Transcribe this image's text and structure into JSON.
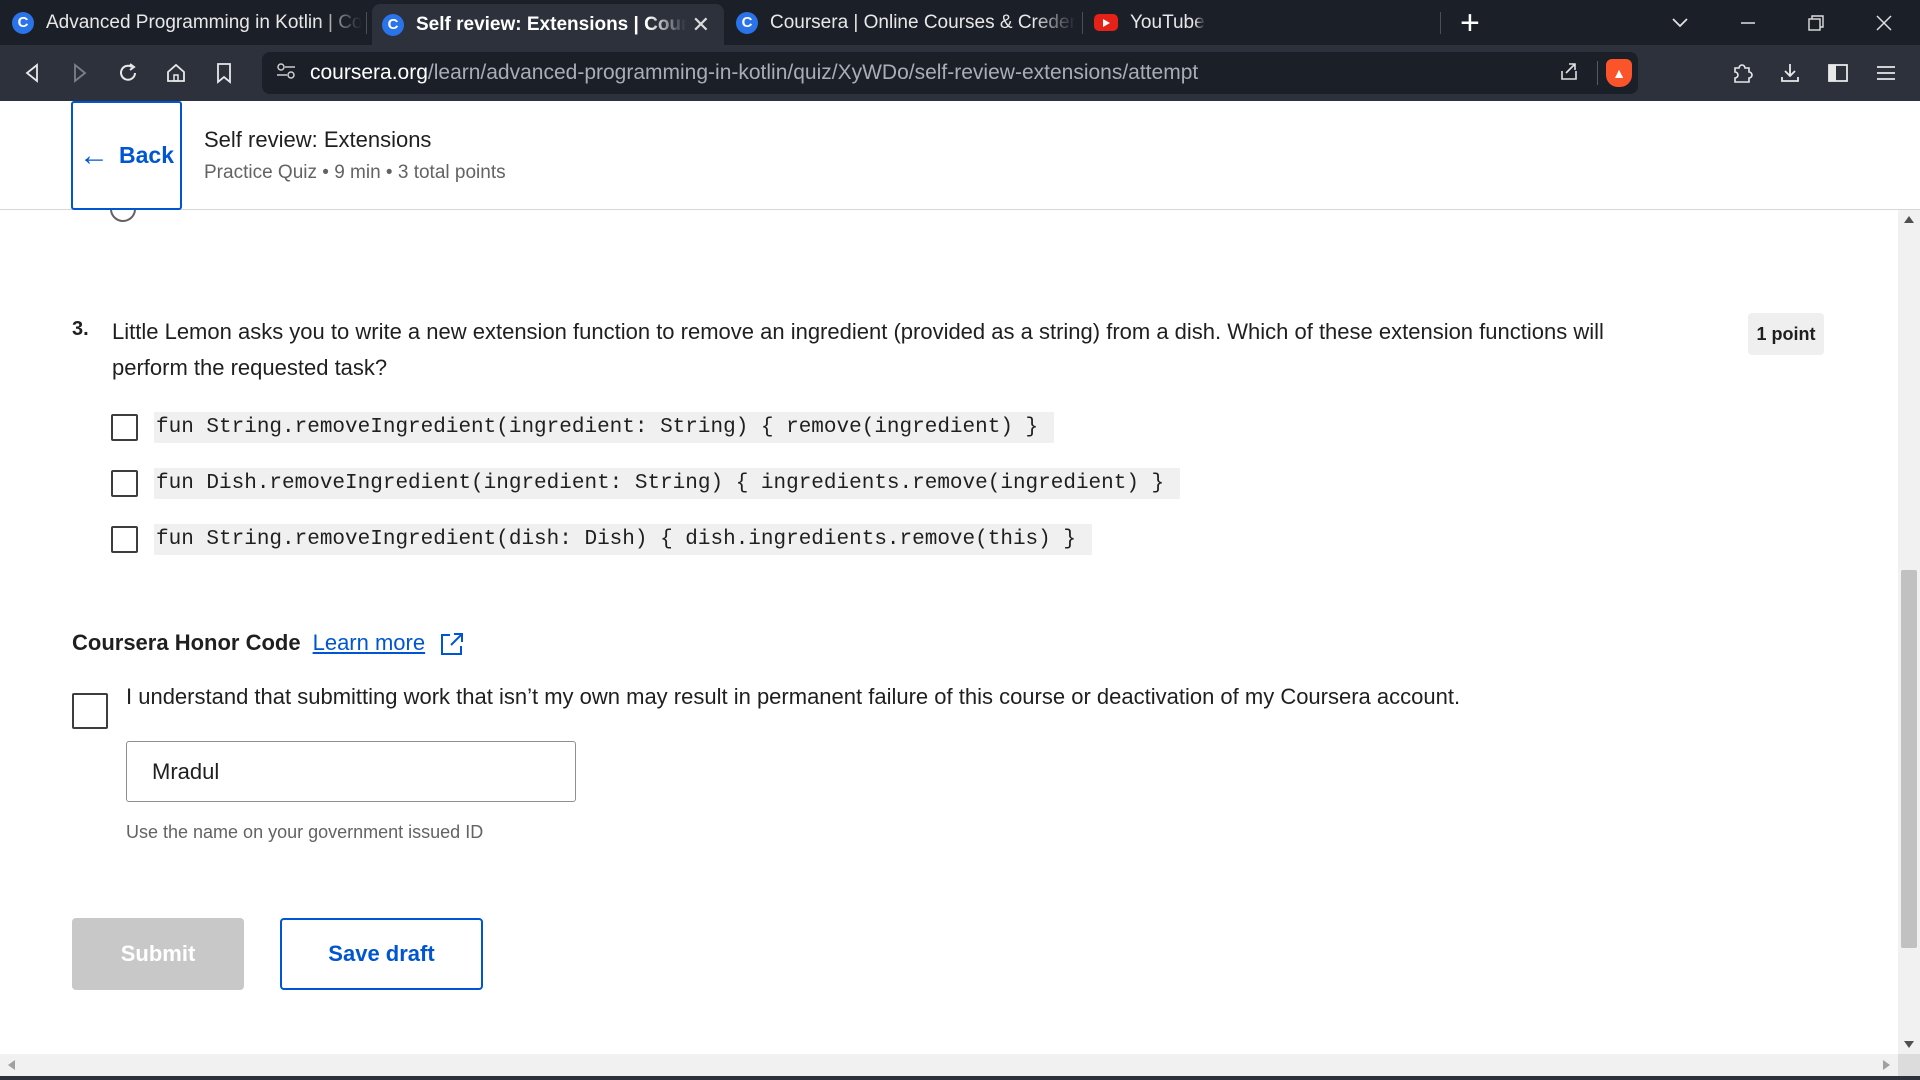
{
  "browser": {
    "tabs": [
      {
        "title": "Advanced Programming in Kotlin | Coursera",
        "icon": "coursera-icon",
        "active": false
      },
      {
        "title": "Self review: Extensions | Coursera",
        "icon": "coursera-icon",
        "active": true
      },
      {
        "title": "Coursera | Online Courses & Credentials",
        "icon": "coursera-icon",
        "active": false
      },
      {
        "title": "YouTube",
        "icon": "youtube-icon",
        "active": false
      }
    ],
    "favicon_letter": "C",
    "close_glyph": "✕",
    "new_tab_glyph": "+",
    "url_domain": "coursera.org",
    "url_path": "/learn/advanced-programming-in-kotlin/quiz/XyWDo/self-review-extensions/attempt"
  },
  "header": {
    "back_label": "Back",
    "title": "Self review: Extensions",
    "subtitle": "Practice Quiz • 9 min • 3 total points"
  },
  "question": {
    "number": "3.",
    "text": "Little Lemon asks you to write a new extension function to remove an ingredient (provided as a string) from a dish. Which of these extension functions will perform the requested task?",
    "points": "1 point",
    "options": [
      "fun String.removeIngredient(ingredient: String) { remove(ingredient) }",
      "fun Dish.removeIngredient(ingredient: String) { ingredients.remove(ingredient) }",
      "fun String.removeIngredient(dish: Dish) { dish.ingredients.remove(this) }"
    ]
  },
  "honor": {
    "title": "Coursera Honor Code",
    "learn_more": "Learn more",
    "statement": "I understand that submitting work that isn’t my own may result in permanent failure of this course or deactivation of my Coursera account.",
    "name_value": "Mradul",
    "name_help": "Use the name on your government issued ID"
  },
  "actions": {
    "submit": "Submit",
    "save_draft": "Save draft"
  },
  "colors": {
    "primary": "#0056d2",
    "tab_bar": "#1b1f28",
    "toolbar": "#2c313c",
    "disabled": "#c8c8c8"
  }
}
